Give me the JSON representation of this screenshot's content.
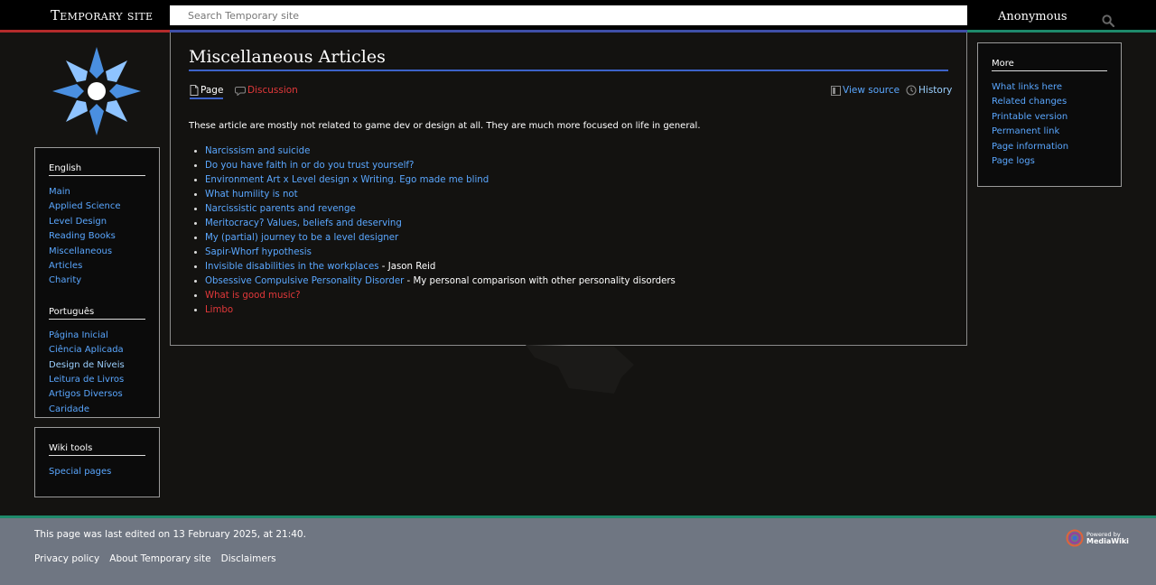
{
  "header": {
    "site_title": "Temporary site",
    "search_placeholder": "Search Temporary site",
    "user": "Anonymous"
  },
  "colors": {
    "accent_red": "#b42b2b",
    "accent_blue": "#3f4fa8",
    "accent_green": "#1e8a6b",
    "link": "#5aa7ff",
    "link_missing": "#e2383a"
  },
  "sidebar": {
    "english": {
      "heading": "English",
      "items": [
        "Main",
        "Applied Science",
        "Level Design",
        "Reading Books",
        "Miscellaneous Articles",
        "Charity"
      ]
    },
    "portugues": {
      "heading": "Português",
      "items": [
        "Página Inicial",
        "Ciência Aplicada",
        "Design de Níveis",
        "Leitura de Livros",
        "Artigos Diversos",
        "Caridade"
      ]
    },
    "tools": {
      "heading": "Wiki tools",
      "items": [
        "Special pages"
      ]
    }
  },
  "more": {
    "heading": "More",
    "items": [
      "What links here",
      "Related changes",
      "Printable version",
      "Permanent link",
      "Page information",
      "Page logs"
    ]
  },
  "content": {
    "title": "Miscellaneous Articles",
    "tabs": {
      "page": "Page",
      "discussion": "Discussion",
      "view_source": "View source",
      "history": "History"
    },
    "intro": "These article are mostly not related to game dev or design at all. They are much more focused on life in general.",
    "articles": [
      {
        "title": "Narcissism and suicide",
        "suffix": ""
      },
      {
        "title": "Do you have faith in or do you trust yourself?",
        "suffix": ""
      },
      {
        "title": "Environment Art x Level design x Writing. Ego made me blind",
        "suffix": ""
      },
      {
        "title": "What humility is not",
        "suffix": ""
      },
      {
        "title": "Narcissistic parents and revenge",
        "suffix": ""
      },
      {
        "title": "Meritocracy? Values, beliefs and deserving",
        "suffix": ""
      },
      {
        "title": "My (partial) journey to be a level designer",
        "suffix": ""
      },
      {
        "title": "Sapir-Whorf hypothesis",
        "suffix": ""
      },
      {
        "title": "Invisible disabilities in the workplaces",
        "suffix": " - Jason Reid"
      },
      {
        "title": "Obsessive Compulsive Personality Disorder",
        "suffix": " - My personal comparison with other personality disorders"
      },
      {
        "title": "What is good music?",
        "suffix": ""
      },
      {
        "title": "Limbo",
        "suffix": ""
      }
    ]
  },
  "footer": {
    "last_edited": "This page was last edited on 13 February 2025, at 21:40.",
    "links": [
      "Privacy policy",
      "About Temporary site",
      "Disclaimers"
    ],
    "powered_by_line1": "Powered by",
    "powered_by_line2": "MediaWiki"
  }
}
